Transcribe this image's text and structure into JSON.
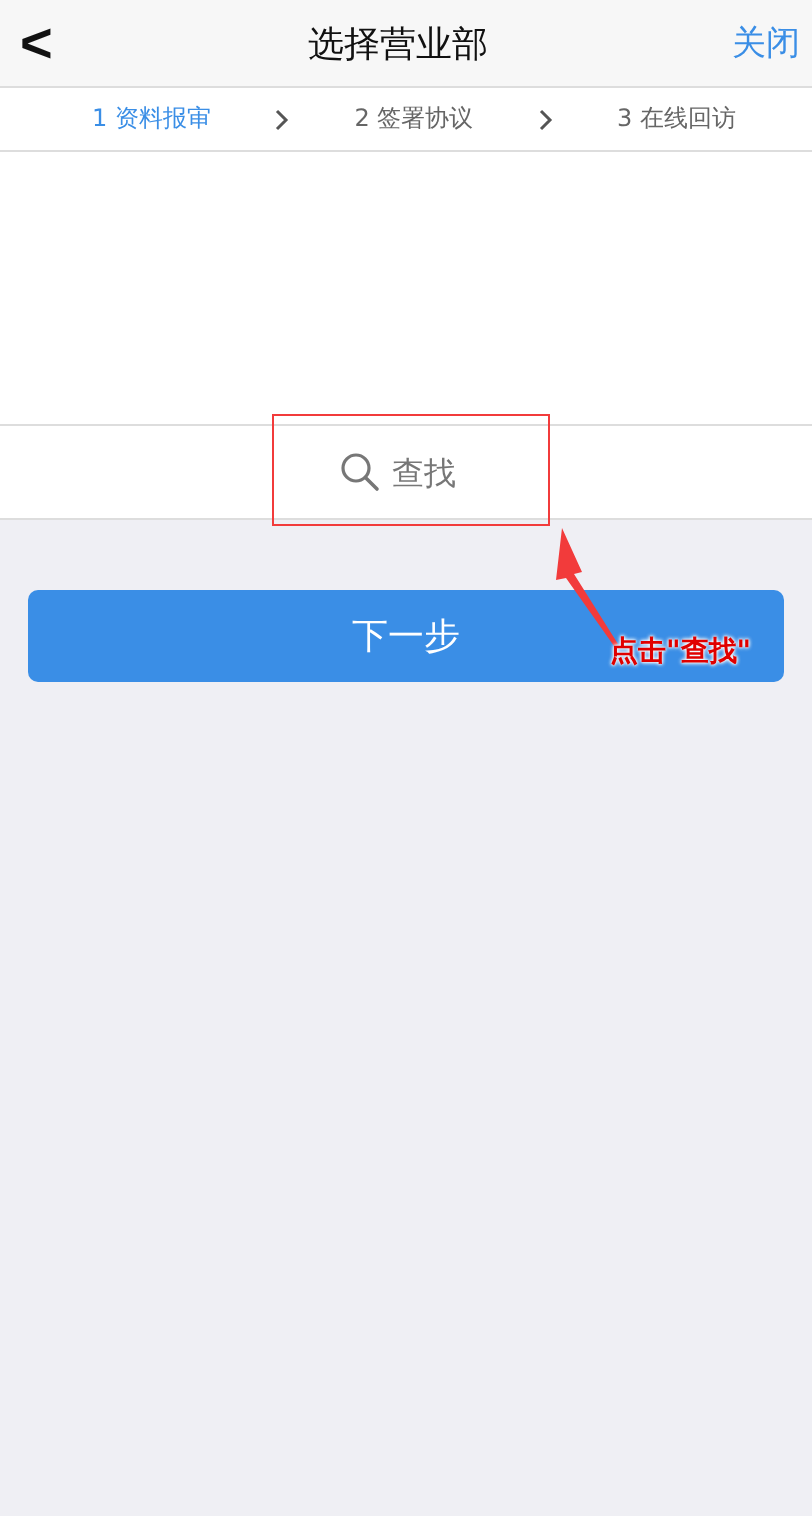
{
  "nav": {
    "back": "<",
    "title": "选择营业部",
    "close": "关闭"
  },
  "steps": [
    {
      "label": "1 资料报审",
      "selected": true
    },
    {
      "label": "2 签署协议",
      "selected": false
    },
    {
      "label": "3 在线回访",
      "selected": false
    }
  ],
  "search": {
    "placeholder": "查找"
  },
  "next_button": "下一步",
  "annotation": {
    "text": "点击\"查找\""
  }
}
